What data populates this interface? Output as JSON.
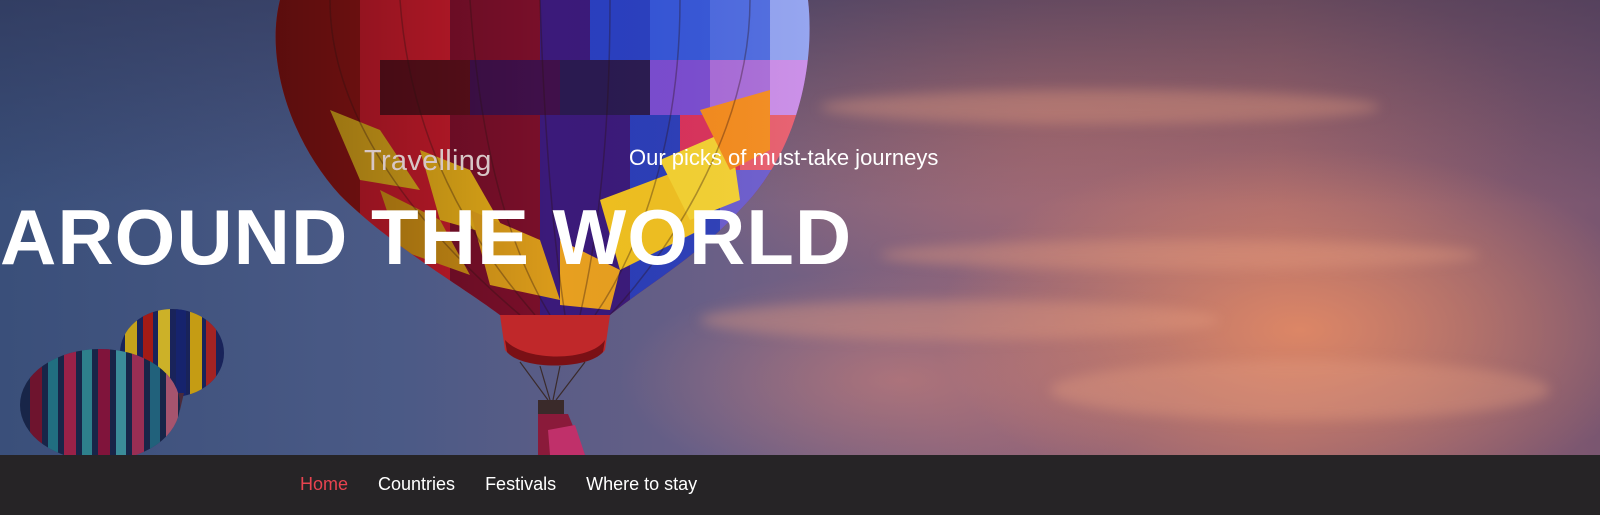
{
  "hero": {
    "subtitle_left": "Travelling",
    "subtitle_right": "Our picks of must-take journeys",
    "headline": "AROUND THE WORLD"
  },
  "nav": {
    "items": [
      {
        "label": "Home",
        "active": true
      },
      {
        "label": "Countries",
        "active": false
      },
      {
        "label": "Festivals",
        "active": false
      },
      {
        "label": "Where to stay",
        "active": false
      }
    ],
    "active_color": "#e8434f",
    "text_color": "#ffffff",
    "background_color": "#262426"
  }
}
